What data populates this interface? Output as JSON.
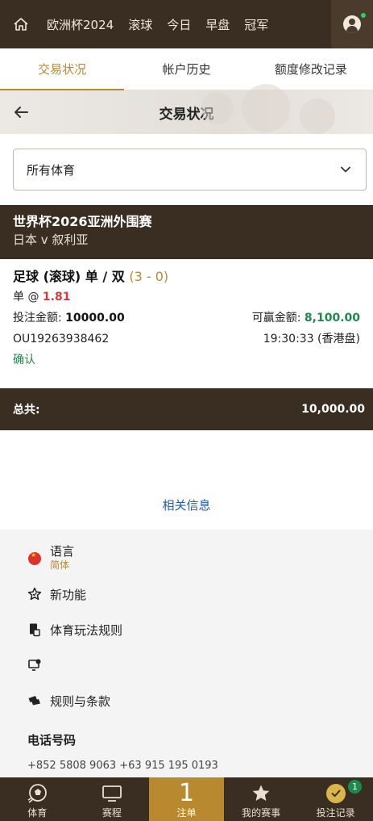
{
  "topnav": {
    "items": [
      "欧洲杯2024",
      "滚球",
      "今日",
      "早盘",
      "冠军"
    ]
  },
  "tabs": [
    "交易状况",
    "帐户历史",
    "额度修改记录"
  ],
  "header": {
    "title": "交易状况"
  },
  "filter": {
    "selected": "所有体育"
  },
  "match": {
    "league": "世界杯2026亚洲外围赛",
    "teams": "日本  v  叙利亚"
  },
  "bet": {
    "market": "足球 (滚球) 单 / 双",
    "score": "(3 - 0)",
    "selection": "单 @",
    "odds": "1.81",
    "stake_label": "投注金额:",
    "stake": "10000.00",
    "win_label": "可赢金额:",
    "win": "8,100.00",
    "ref": "OU19263938462",
    "time": "19:30:33 (香港盘)",
    "status": "确认"
  },
  "total": {
    "label": "总共:",
    "value": "10,000.00"
  },
  "related": "相关信息",
  "footer": {
    "language_label": "语言",
    "language_value": "简体",
    "new_features": "新功能",
    "sports_rules": "体育玩法规则",
    "terms": "规则与条款",
    "phone_title": "电话号码",
    "phones": "+852 5808 9063    +63 915 195 0193"
  },
  "bottombar": {
    "sports": "体育",
    "schedule": "赛程",
    "betslip": "注单",
    "betslip_count": "1",
    "my_events": "我的赛事",
    "bet_records": "投注记录",
    "bet_records_badge": "1"
  },
  "colors": {
    "brand_dark": "#3a2e22",
    "accent_gold": "#b8892f",
    "win_green": "#1c8a4a",
    "odds_red": "#d23b3b"
  }
}
